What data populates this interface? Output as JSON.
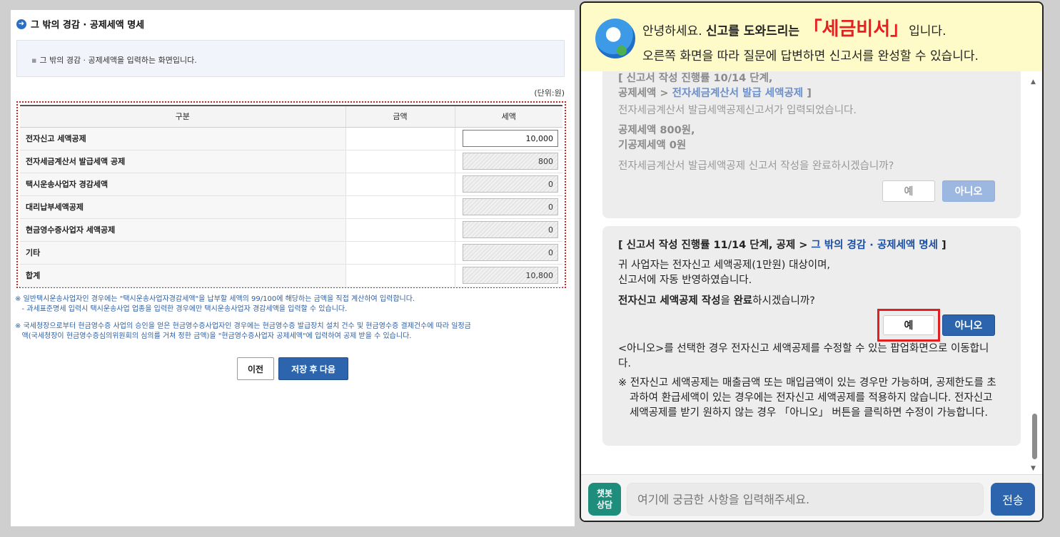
{
  "form": {
    "title": "그 밖의 경감 · 공제세액 명세",
    "info": "그 밖의 경감 · 공제세액을 입력하는 화면입니다.",
    "unit": "(단위:원)",
    "columns": [
      "구분",
      "금액",
      "세액"
    ],
    "rows": [
      {
        "label": "전자신고 세액공제",
        "amount": "",
        "tax": "10,000",
        "editable": true
      },
      {
        "label": "전자세금계산서 발급세액 공제",
        "amount": "",
        "tax": "800",
        "editable": false
      },
      {
        "label": "택시운송사업자 경감세액",
        "amount": "",
        "tax": "0",
        "editable": false
      },
      {
        "label": "대리납부세액공제",
        "amount": "",
        "tax": "0",
        "editable": false
      },
      {
        "label": "현금영수증사업자 세액공제",
        "amount": "",
        "tax": "0",
        "editable": false
      },
      {
        "label": "기타",
        "amount": "",
        "tax": "0",
        "editable": false
      },
      {
        "label": "합계",
        "amount": "",
        "tax": "10,800",
        "editable": false
      }
    ],
    "note1_line1": "※ 일반택시운송사업자인 경우에는 \"택시운송사업자경감세액\"을 납부할 세액의 99/100에 해당하는 금액을 직접 계산하여 입력합니다.",
    "note1_line2": "   - 과세표준명세 입력시 택시운송사업 업종을 입력한 경우에만 택시운송사업자 경감세액을 입력할 수 있습니다.",
    "note2_line1": "※ 국세청장으로부터 현금영수증 사업의 승인을 얻은 현금영수증사업자인 경우에는 현금영수증 발급장치 설치 건수 및 현금영수증 결제건수에 따라 일정금",
    "note2_line2": "   액(국세청장이 현금영수증심의위원회의 심의를 거쳐 정한 금액)을 \"현금영수증사업자 공제세액\"에 입력하여 공제 받을 수 있습니다.",
    "btn_prev": "이전",
    "btn_next": "저장 후 다음"
  },
  "chat": {
    "greeting_pre": "안녕하세요.",
    "greeting_strong": "신고를 도와드리는",
    "brand": "「세금비서」",
    "greeting_post": "입니다.",
    "subtitle": "오른쪽 화면을 따라 질문에 답변하면 신고서를 완성할 수 있습니다.",
    "msg1": {
      "step_prefix": "[ 신고서 작성 진행률 10/14 단계,",
      "step_line2_prefix": "공제세액 >",
      "step_link": "전자세금계산서 발급 세액공제",
      "step_suffix": "]",
      "line1": "전자세금계산서 발급세액공제신고서가 입력되었습니다.",
      "line2a": "공제세액 800원,",
      "line2b": "기공제세액 0원",
      "line3": "전자세금계산서 발급세액공제 신고서 작성을 완료하시겠습니까?",
      "yes": "예",
      "no": "아니오"
    },
    "msg2": {
      "step_prefix": "[ 신고서 작성 진행률 11/14 단계, 공제 >",
      "step_link": "그 밖의 경감 · 공제세액 명세",
      "step_suffix": "]",
      "line1a": "귀 사업자는 전자신고 세액공제(1만원) 대상이며,",
      "line1b": "신고서에 자동 반영하였습니다.",
      "q_strong1": "전자신고 세액공제 작성",
      "q_mid": "을",
      "q_strong2": "완료",
      "q_end": "하시겠습니까?",
      "yes": "예",
      "no": "아니오",
      "line3": "<아니오>를 선택한 경우 전자신고 세액공제를 수정할 수 있는 팝업화면으로 이동합니다.",
      "line4": "※ 전자신고 세액공제는 매출금액 또는 매입금액이 있는 경우만 가능하며, 공제한도를 초과하여 환급세액이 있는 경우에는 전자신고 세액공제를 적용하지 않습니다. 전자신고 세액공제를 받기 원하지 않는 경우 「아니오」 버튼을 클릭하면 수정이 가능합니다."
    },
    "bot_badge": "챗봇\n상담",
    "input_placeholder": "여기에 궁금한 사항을 입력해주세요.",
    "send": "전송"
  }
}
